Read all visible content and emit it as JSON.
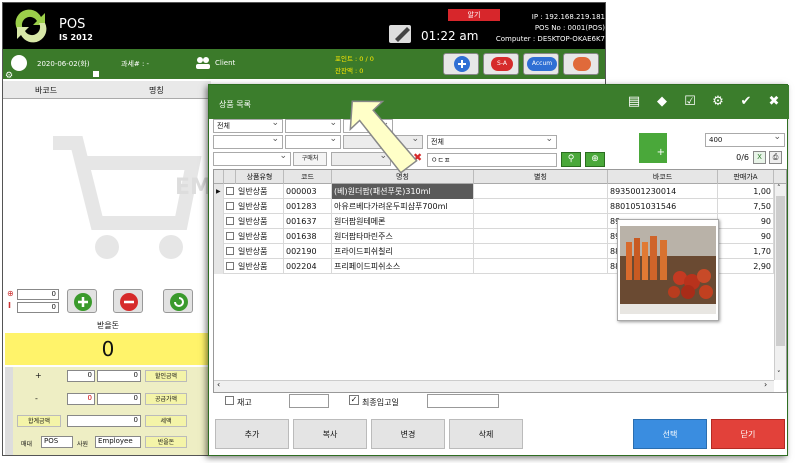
{
  "pos": {
    "logo_title": "POS",
    "logo_version": "IS 2012",
    "clock": "01:22 am",
    "alarm_label": "알기",
    "ip": "IP : 192.168.219.181",
    "pos_no": "POS No : 0001(POS)",
    "computer": "Computer : DESKTOP-OKAE6K7",
    "date": "2020-06-02(화)",
    "tax": "과세# : -",
    "client": "Client",
    "points": "포인트 : 0 / 0",
    "balance": "잔잔액 : 0",
    "btn_sa": "S-A",
    "btn_accum": "Accum",
    "col_barcode": "바코드",
    "col_name": "명칭",
    "cart_text": "EM",
    "qty1": "0",
    "qty2": "0",
    "received_label": "받을돈",
    "received_value": "0",
    "plus_label": "+",
    "minus_label": "-",
    "plus_v1": "0",
    "plus_v2": "0",
    "minus_v1": "0",
    "minus_v2": "0",
    "discount_label": "할인금액",
    "supply_label": "공급가액",
    "vat_label": "세액",
    "total_label": "합계금액",
    "total_value": "0",
    "cashier_label": "매대",
    "cashier_value": "POS",
    "staff_label": "사원",
    "staff_value": "Employee",
    "change_label": "반을돈"
  },
  "dialog": {
    "title": "상품 목록",
    "filter_all_1": "전체",
    "filter_all_2": "전체",
    "buyer_label": "구매처",
    "search_value": "ㅇㄷㅍ",
    "page_size": "400",
    "count": "0/6",
    "columns": [
      "상품유형",
      "코드",
      "명칭",
      "별칭",
      "바코드",
      "판매가A"
    ],
    "rows": [
      {
        "type": "일반상품",
        "code": "000003",
        "name": "(베)원더팜(패션푸룻)310ml",
        "alias": "",
        "barcode": "8935001230014",
        "price": "1,00"
      },
      {
        "type": "일반상품",
        "code": "001283",
        "name": "아유르베다가려운두피샴푸700ml",
        "alias": "",
        "barcode": "8801051031546",
        "price": "7,50"
      },
      {
        "type": "일반상품",
        "code": "001637",
        "name": "원더팜원테메론",
        "alias": "",
        "barcode": "89",
        "price": "90"
      },
      {
        "type": "일반상품",
        "code": "001638",
        "name": "원더팜타마린주스",
        "alias": "",
        "barcode": "89",
        "price": "90"
      },
      {
        "type": "일반상품",
        "code": "002190",
        "name": "프라이드피쉬칠리",
        "alias": "",
        "barcode": "88",
        "price": "1,70"
      },
      {
        "type": "일반상품",
        "code": "002204",
        "name": "프리페이드피쉬소스",
        "alias": "",
        "barcode": "88",
        "price": "2,90"
      }
    ],
    "stock_label": "재고",
    "last_in_label": "최종입고일",
    "btn_add": "추가",
    "btn_copy": "복사",
    "btn_change": "변경",
    "btn_delete": "삭제",
    "btn_select": "선택",
    "btn_close": "닫기"
  },
  "colors": {
    "title_green": "#3b7d2c",
    "received_yellow": "#fff36a",
    "select_blue": "#3a8de0",
    "close_red": "#e2413a"
  },
  "icons": [
    "logo-icon",
    "pen-icon",
    "calendar-icon",
    "client-icon",
    "plus-icon",
    "sa-icon",
    "accum-icon",
    "card-icon",
    "add-circle-icon",
    "minus-circle-icon",
    "refresh-icon",
    "book-icon",
    "tag-icon",
    "edit-icon",
    "gear-icon",
    "check-icon",
    "close-icon",
    "search-icon",
    "zoom-icon",
    "folder-icon",
    "excel-icon",
    "print-icon"
  ]
}
